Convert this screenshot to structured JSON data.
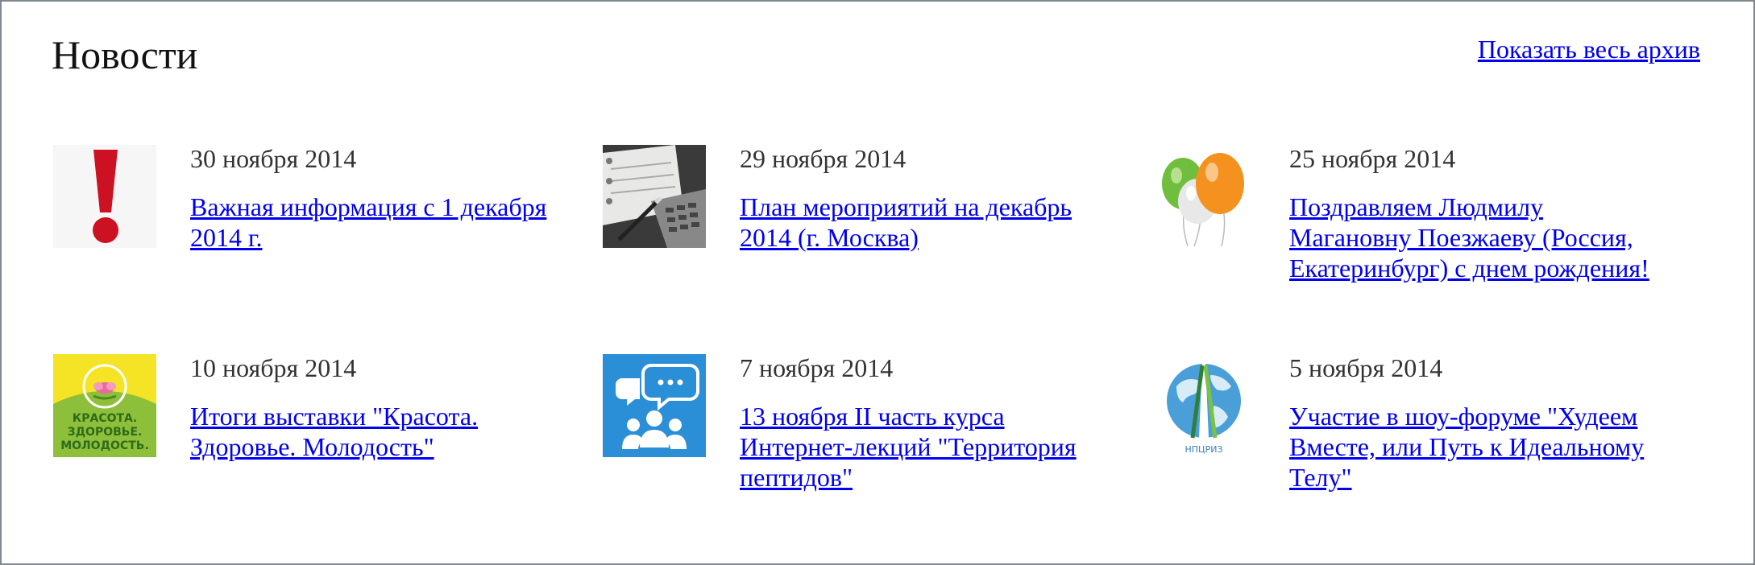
{
  "header": {
    "title": "Новости",
    "archive_link": "Показать весь архив"
  },
  "colors": {
    "link": "#0000ee",
    "text": "#333333",
    "border": "#808890",
    "exclamation_red": "#cc1122",
    "tile_blue": "#2a8fd6",
    "expo_yellow": "#f4e425",
    "expo_green": "#8ebf3a"
  },
  "news": [
    {
      "date": "30 ноября 2014",
      "title_lines": [
        "Важная информация с 1 декабря",
        "2014 г."
      ],
      "icon": "exclamation-icon"
    },
    {
      "date": "29 ноября 2014",
      "title_lines": [
        "План мероприятий на декабрь",
        "2014 (г. Москва)"
      ],
      "icon": "planner-calculator-photo"
    },
    {
      "date": "25 ноября 2014",
      "title_lines": [
        "Поздравляем Людмилу",
        "Магановну Поезжаеву (Россия,",
        "Екатеринбург) с днем рождения!"
      ],
      "icon": "balloons-icon"
    },
    {
      "date": "10 ноября 2014",
      "title_lines": [
        "Итоги выставки \"Красота.",
        "Здоровье. Молодость\""
      ],
      "icon": "expo-logo",
      "thumb_text": [
        "КРАСОТА.",
        "ЗДОРОВЬЕ.",
        "МОЛОДОСТЬ."
      ]
    },
    {
      "date": "7 ноября 2014",
      "title_lines": [
        "13 ноября II часть курса",
        "Интернет-лекций \"Территория",
        "пептидов\""
      ],
      "icon": "community-chat-icon"
    },
    {
      "date": "5 ноября 2014",
      "title_lines": [
        "Участие в шоу-форуме \"Худеем",
        "Вместе, или Путь к Идеальному",
        "Телу\""
      ],
      "icon": "globe-logo",
      "thumb_text": [
        "НПЦРИЗ"
      ]
    }
  ]
}
